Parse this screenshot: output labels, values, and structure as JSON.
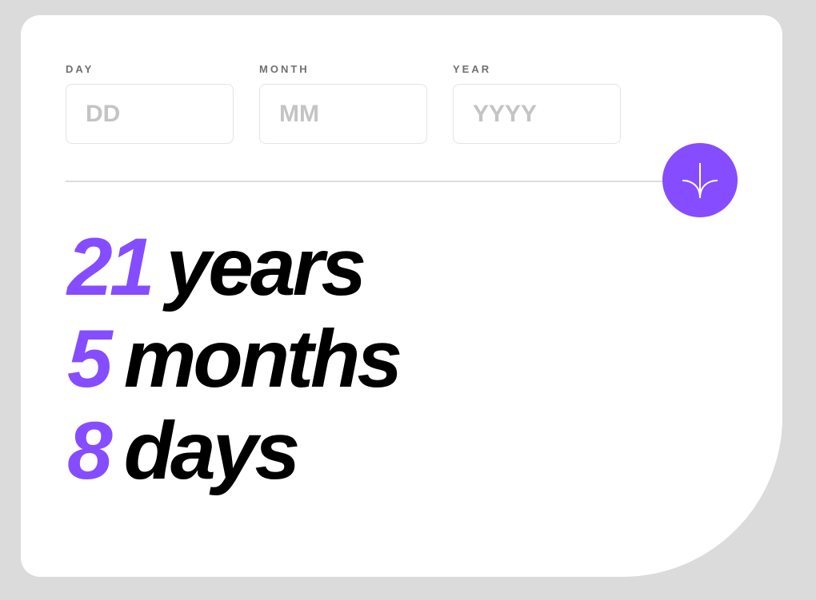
{
  "form": {
    "day": {
      "label": "DAY",
      "placeholder": "DD",
      "value": ""
    },
    "month": {
      "label": "MONTH",
      "placeholder": "MM",
      "value": ""
    },
    "year": {
      "label": "YEAR",
      "placeholder": "YYYY",
      "value": ""
    }
  },
  "submit": {
    "icon": "arrow-down-icon",
    "color": "#854dff"
  },
  "results": {
    "years": {
      "value": "21",
      "unit": "years"
    },
    "months": {
      "value": "5",
      "unit": "months"
    },
    "days": {
      "value": "8",
      "unit": "days"
    }
  },
  "colors": {
    "accent": "#854dff",
    "background": "#dbdbdb",
    "card": "#ffffff",
    "label": "#716f6f",
    "text": "#000000"
  }
}
